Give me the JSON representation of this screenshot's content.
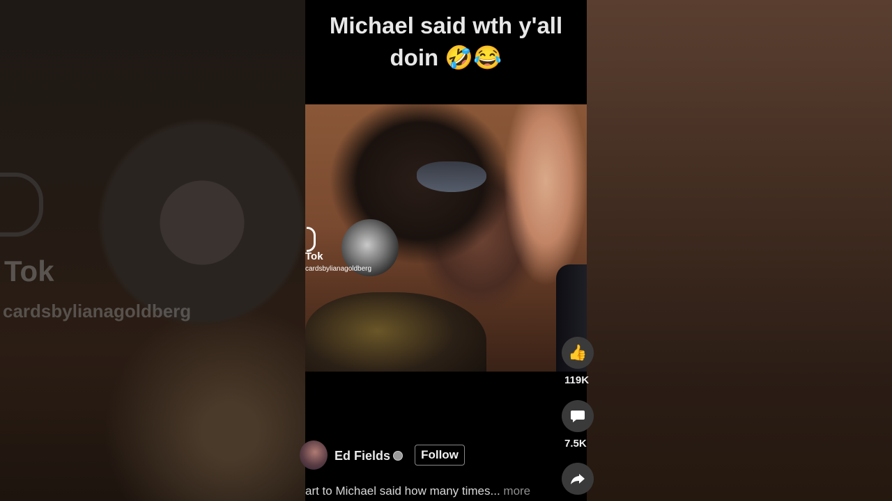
{
  "caption": {
    "line1": "Michael said wth y'all",
    "line2": "doin 🤣😂"
  },
  "watermark": {
    "brand": "Tok",
    "handle": "cardsbylianagoldberg",
    "left_brand": "Tok",
    "left_handle": "cardsbylianagoldberg"
  },
  "actions": {
    "like_count": "119K",
    "comment_count": "7.5K"
  },
  "author": {
    "name": "Ed Fields",
    "follow_label": "Follow"
  },
  "description": {
    "text": "art to Michael said how many times...",
    "more_label": "more"
  },
  "colors": {
    "video_bg": "#000000",
    "button_bg": "#3a3a3a",
    "text": "#e8e8e8"
  }
}
